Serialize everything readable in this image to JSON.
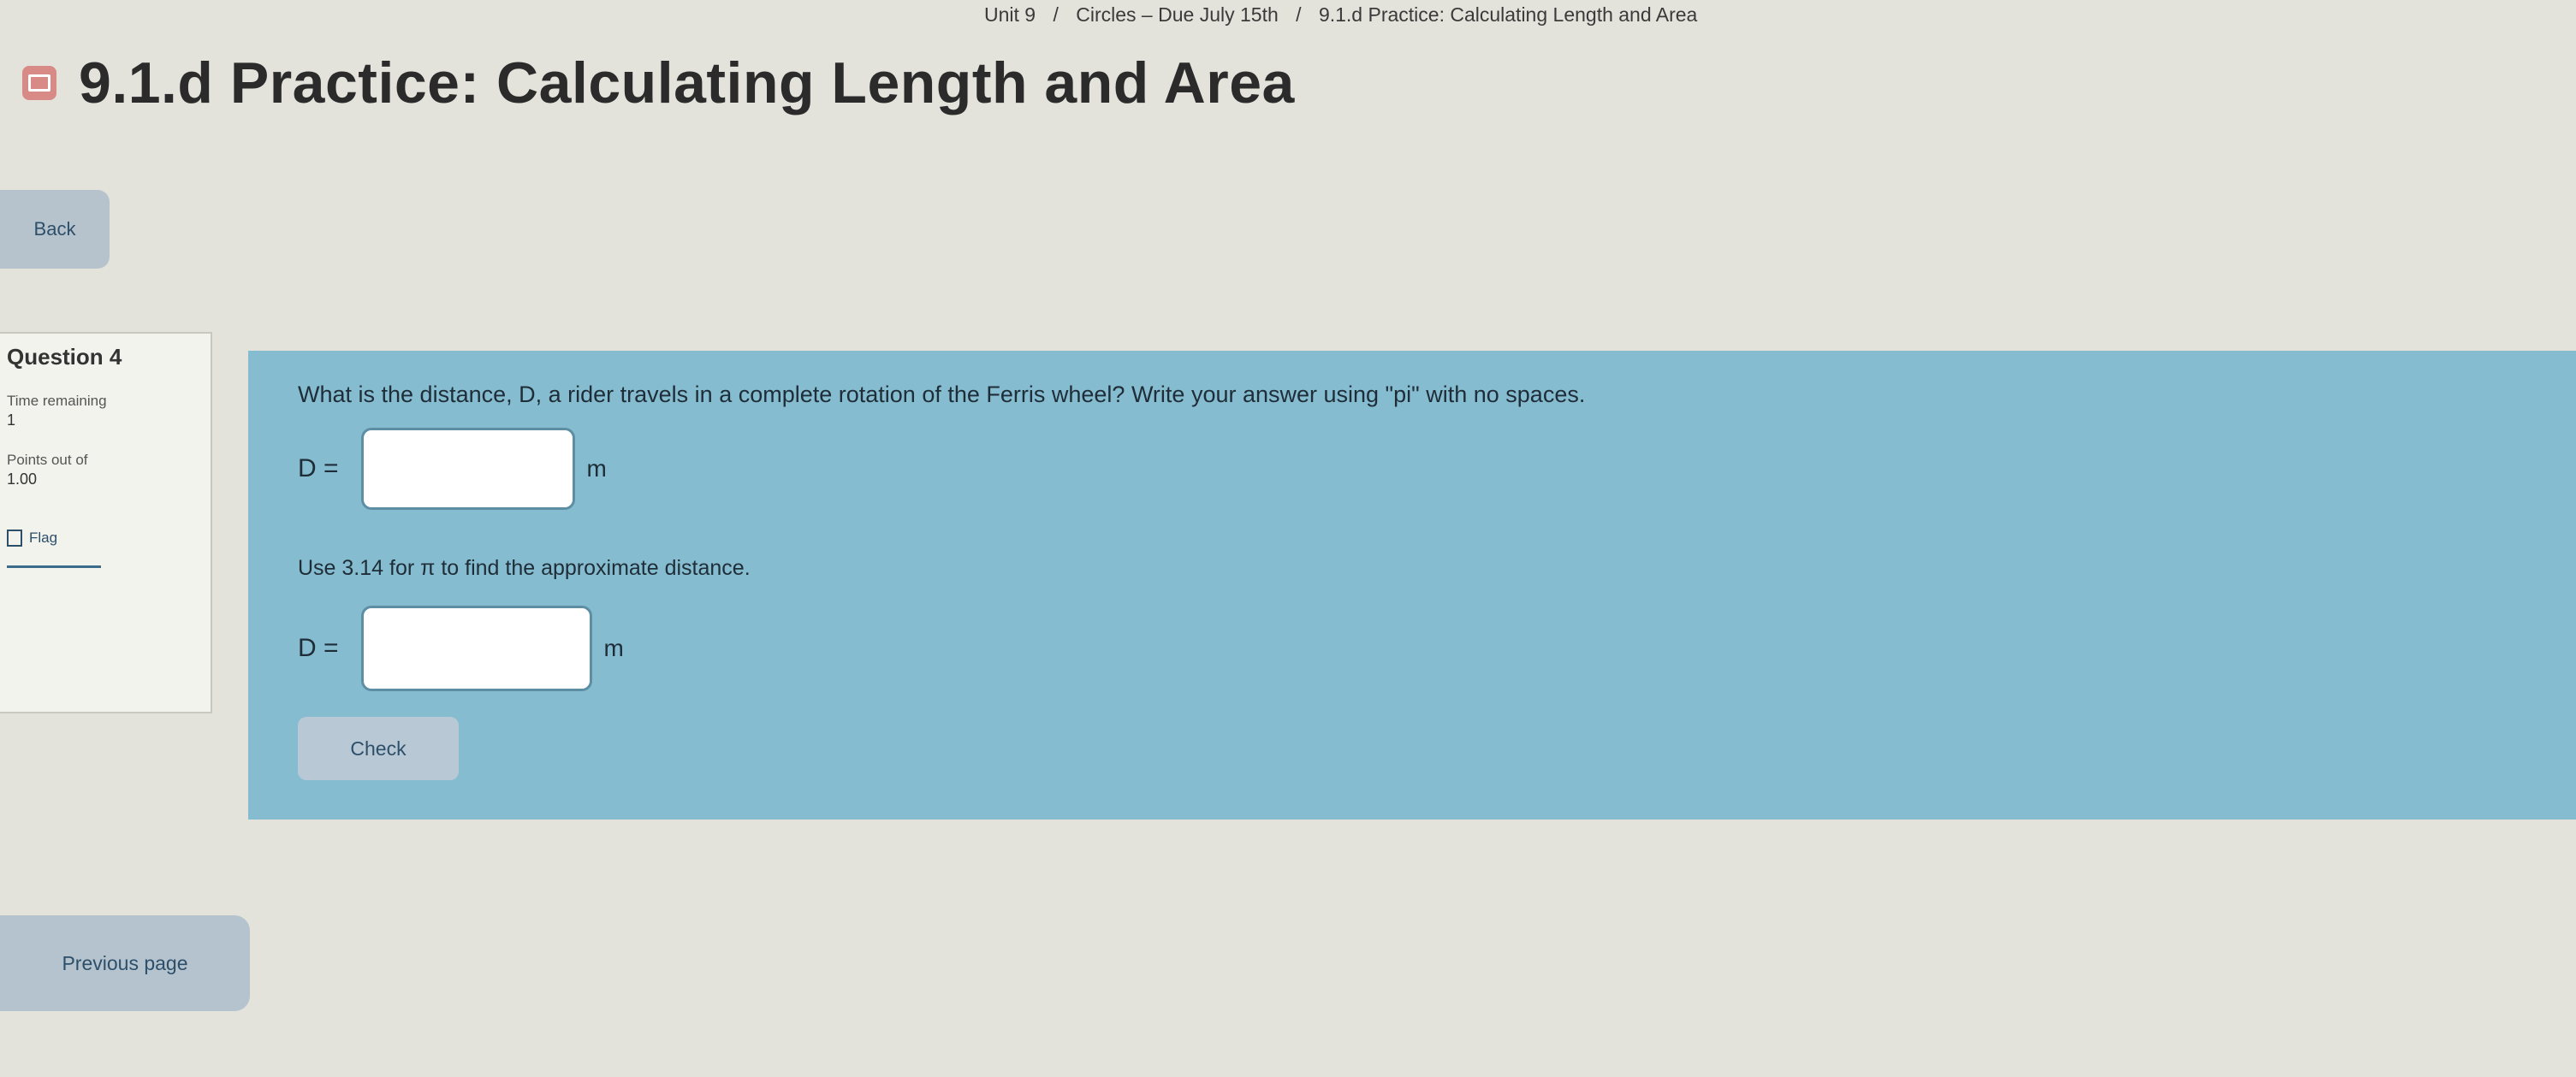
{
  "breadcrumb": {
    "unit": "Unit 9",
    "lesson": "Circles – Due July 15th",
    "current": "9.1.d Practice: Calculating Length and Area"
  },
  "header": {
    "title": "9.1.d Practice: Calculating Length and Area",
    "icon": "quiz-icon",
    "icon_color": "#d88a86"
  },
  "back_label": "Back",
  "quiz_nav": {
    "question_label": "Question 4",
    "time_label": "Time remaining",
    "time_value": "1",
    "points_label": "Points out of",
    "points_value": "1.00",
    "flag_label": "Flag"
  },
  "question": {
    "text": "What is the distance, D, a rider travels in a complete rotation of the Ferris wheel? Write your answer using \"pi\" with no spaces.",
    "answer1": {
      "variable": "D =",
      "value": "",
      "unit": "m"
    },
    "hint": "Use 3.14 for π to find the approximate distance.",
    "answer2": {
      "variable": "D =",
      "value": "",
      "unit": "m"
    },
    "check_label": "Check"
  },
  "previous_label": "Previous page",
  "colors": {
    "panel": "#86bccf",
    "button": "#b8c9d5",
    "background": "#e3e3dc"
  }
}
